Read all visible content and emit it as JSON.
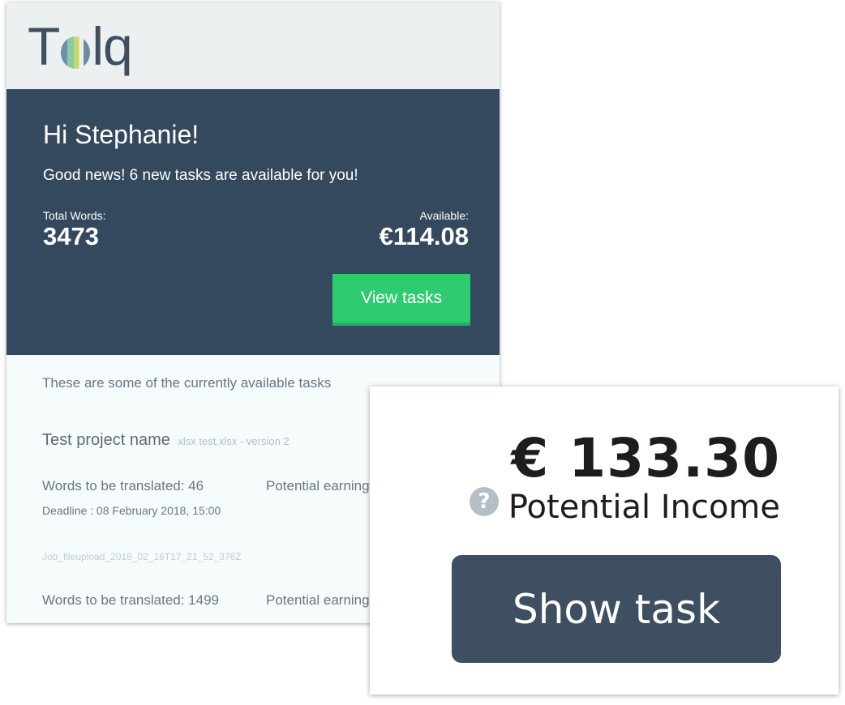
{
  "email": {
    "brand": {
      "logo_left": "T",
      "logo_right": "lq"
    },
    "greeting": "Hi Stephanie!",
    "news": "Good news! 6 new tasks are available for you!",
    "total_words": {
      "label": "Total Words:",
      "value": "3473"
    },
    "available": {
      "label": "Available:",
      "value": "€114.08"
    },
    "view_tasks_button": "View tasks",
    "tasks_intro": "These are some of the currently available tasks",
    "project": {
      "name": "Test project name",
      "file": "xlsx test.xlsx - version 2"
    },
    "task1": {
      "words": "Words to be translated: 46",
      "earning": "Potential earning",
      "deadline": "Deadline : 08 February 2018, 15:00"
    },
    "job_file": "Job_fileupload_2018_02_16T17_21_52_376Z",
    "task2": {
      "words": "Words to be translated: 1499",
      "earning": "Potential earning"
    },
    "colors": {
      "header_bg": "#34495e",
      "accent_green": "#2ecc71"
    }
  },
  "zoom": {
    "amount": "€ 133.30",
    "help_icon": "question-circle-icon",
    "income_label": "Potential Income",
    "show_task_button": "Show task",
    "colors": {
      "button_bg": "#3d4f60"
    }
  }
}
